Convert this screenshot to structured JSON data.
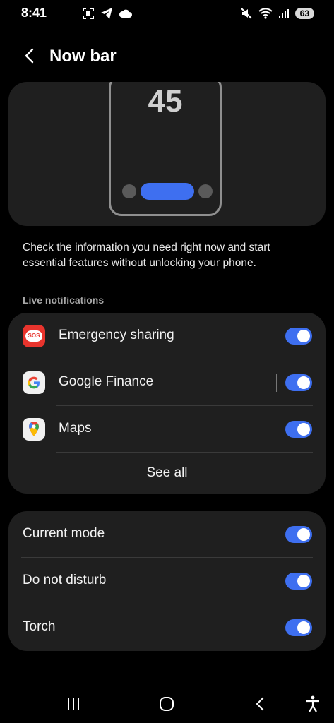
{
  "status_bar": {
    "time": "8:41",
    "left_icons": [
      "screenshot-icon",
      "telegram-icon",
      "cloud-icon"
    ],
    "right_icons": [
      "mute-icon",
      "wifi-icon",
      "signal-icon"
    ],
    "battery": "63"
  },
  "header": {
    "title": "Now bar",
    "back_icon": "back-arrow-icon"
  },
  "preview": {
    "clock": "45"
  },
  "description": "Check the information you need right now and start essential features without unlocking your phone.",
  "live_notifications": {
    "label": "Live notifications",
    "items": [
      {
        "label": "Emergency sharing",
        "icon": "sos-icon",
        "icon_text": "SOS",
        "enabled": true
      },
      {
        "label": "Google Finance",
        "icon": "google-icon",
        "enabled": true
      },
      {
        "label": "Maps",
        "icon": "maps-icon",
        "enabled": true
      }
    ],
    "see_all": "See all"
  },
  "settings": {
    "items": [
      {
        "label": "Current mode",
        "enabled": true
      },
      {
        "label": "Do not disturb",
        "enabled": true
      },
      {
        "label": "Torch",
        "enabled": true
      }
    ]
  },
  "colors": {
    "accent": "#3e6ff0",
    "card": "#1f1f1f",
    "background": "#000000"
  },
  "nav_bar": [
    "recents-icon",
    "home-icon",
    "back-icon",
    "accessibility-icon"
  ]
}
